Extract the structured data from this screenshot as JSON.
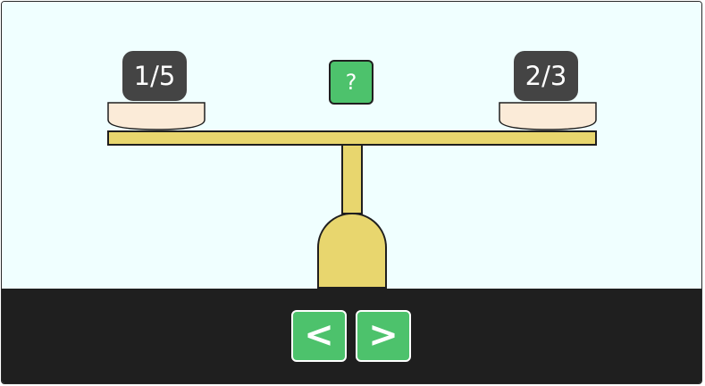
{
  "colors": {
    "background": "#f0ffff",
    "control_bar": "#1f1f1f",
    "scale_yellow": "#e8d66e",
    "pan_fill": "#fbebd8",
    "weight_tile": "#444444",
    "button_green": "#4dc26c"
  },
  "scale": {
    "left_weight": "1/5",
    "right_weight": "2/3",
    "compare_label": "?"
  },
  "controls": {
    "prev_label": "<",
    "next_label": ">"
  }
}
